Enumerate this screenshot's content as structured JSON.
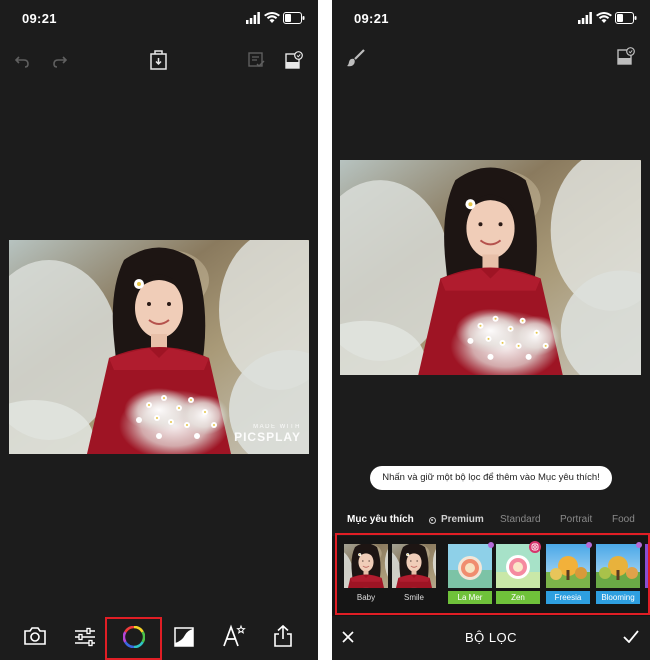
{
  "left": {
    "status": {
      "time": "09:21"
    },
    "watermark": {
      "line1": "MADE WITH",
      "line2": "PICSPLAY"
    },
    "toolbar_icons": [
      "camera-icon",
      "adjust-sliders-icon",
      "color-wheel-icon",
      "curves-icon",
      "text-icon",
      "share-icon"
    ]
  },
  "right": {
    "status": {
      "time": "09:21"
    },
    "tooltip": "Nhấn và giữ một bộ lọc để thêm vào Mục yêu thích!",
    "categories": {
      "favorites": "Mục yêu thích",
      "premium": "Premium",
      "standard": "Standard",
      "portrait": "Portrait",
      "food": "Food"
    },
    "filters": [
      {
        "label": "Baby",
        "color": "#1c1c1c"
      },
      {
        "label": "Smile",
        "color": "#1c1c1c"
      },
      {
        "label": "La Mer",
        "color": "#6fc13a"
      },
      {
        "label": "Zen",
        "color": "#6fc13a"
      },
      {
        "label": "Freesia",
        "color": "#2e9fe0"
      },
      {
        "label": "Blooming",
        "color": "#2e9fe0"
      }
    ],
    "bottom": {
      "title": "BỘ LỌC"
    }
  },
  "colors": {
    "highlight": "#e01e25",
    "background": "#1c1c1c",
    "premium_dot": "#b46bd8"
  }
}
